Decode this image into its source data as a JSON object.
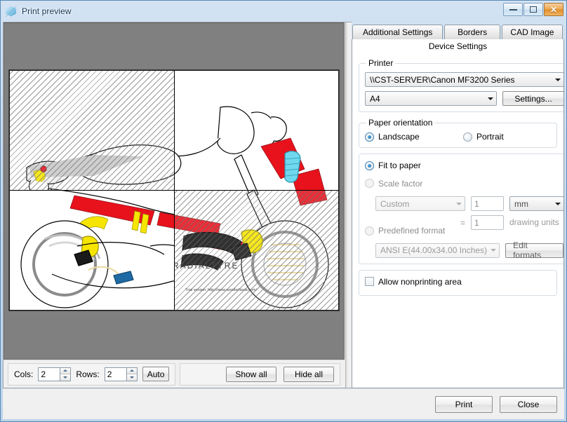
{
  "window": {
    "title": "Print preview",
    "icon": "cube-icon",
    "buttons": {
      "minimize": "minimize-icon",
      "maximize": "maximize-icon",
      "close": "✕"
    }
  },
  "preview": {
    "cols": 2,
    "rows": 2,
    "tiles": [
      {
        "index": 1,
        "hidden": true
      },
      {
        "index": 2,
        "hidden": false
      },
      {
        "index": 3,
        "hidden": false
      },
      {
        "index": 4,
        "hidden": true
      }
    ],
    "watermark": "Trial version: http://www.wonderfiasia.com/",
    "toolbar": {
      "cols_label": "Cols:",
      "cols_value": "2",
      "rows_label": "Rows:",
      "rows_value": "2",
      "auto_label": "Auto",
      "show_all_label": "Show all",
      "hide_all_label": "Hide all"
    }
  },
  "settings": {
    "tabs": [
      {
        "label": "Additional Settings",
        "active": false
      },
      {
        "label": "Borders",
        "active": false
      },
      {
        "label": "CAD Image",
        "active": false
      }
    ],
    "active_tab_label": "Device Settings",
    "printer_group": {
      "legend": "Printer",
      "printer_value": "\\\\CST-SERVER\\Canon MF3200 Series",
      "paper_size_value": "A4",
      "settings_button": "Settings..."
    },
    "orientation_group": {
      "legend": "Paper orientation",
      "landscape_label": "Landscape",
      "portrait_label": "Portrait",
      "selected": "Landscape"
    },
    "scale_group": {
      "fit_to_paper_label": "Fit to paper",
      "scale_factor_label": "Scale factor",
      "selected": "Fit to paper",
      "scale_preset_value": "Custom",
      "scale_numerator": "1",
      "unit_value": "mm",
      "equals_sign": "=",
      "scale_denominator": "1",
      "drawing_units_label": "drawing units",
      "predefined_format_label": "Predefined format",
      "predefined_format_value": "ANSI E(44.00x34.00 Inches)",
      "edit_formats_button": "Edit formats"
    },
    "nonprinting_group": {
      "allow_nonprinting_label": "Allow nonprinting area",
      "checked": false
    }
  },
  "footer": {
    "print_label": "Print",
    "close_label": "Close"
  },
  "colors": {
    "titlebar_accent": "#bcd4ea",
    "preview_bg": "#808080",
    "close_button": "#e08d26",
    "radio_accent": "#1e6ba8",
    "art_red": "#e8121c",
    "art_yellow": "#f6e500",
    "art_cyan": "#6fd8ef"
  }
}
